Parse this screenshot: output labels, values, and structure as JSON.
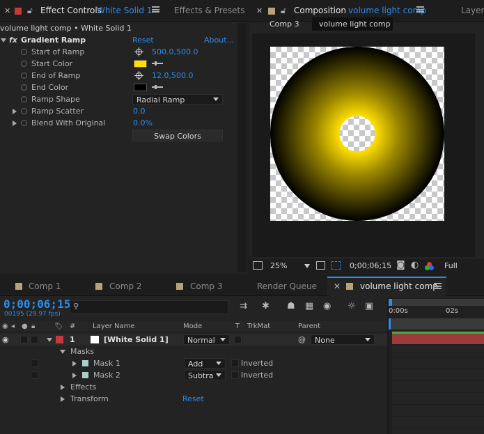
{
  "colors": {
    "accent": "#2d8ceb",
    "label_red": "#c83a3a",
    "label_tan": "#b8a27a",
    "start_color": "#ffde00",
    "end_color": "#000000",
    "layer_bar": "#9c3a3a",
    "work_area": "#2d8ceb"
  },
  "effect_controls": {
    "tab_title": "Effect Controls",
    "tab_layer": "White Solid 1",
    "tab_presets": "Effects & Presets",
    "breadcrumb": "volume light comp • White Solid 1",
    "effect_name": "Gradient Ramp",
    "reset": "Reset",
    "about": "About...",
    "props": {
      "start_of_ramp": {
        "label": "Start of Ramp",
        "value": "500.0,500.0"
      },
      "start_color": {
        "label": "Start Color"
      },
      "end_of_ramp": {
        "label": "End of Ramp",
        "value": "12.0,500.0"
      },
      "end_color": {
        "label": "End Color"
      },
      "ramp_shape": {
        "label": "Ramp Shape",
        "value": "Radial Ramp"
      },
      "ramp_scatter": {
        "label": "Ramp Scatter",
        "value": "0.0"
      },
      "blend_with_original": {
        "label": "Blend With Original",
        "value": "0.0%"
      }
    },
    "swap_colors": "Swap Colors"
  },
  "composition": {
    "tab_prefix": "Composition",
    "tab_name": "volume light comp",
    "tab_layer": "Layer",
    "nav": [
      "Comp 3",
      "volume light comp"
    ],
    "zoom": "25%",
    "timecode": "0;00;06;15",
    "resolution": "Full"
  },
  "timeline": {
    "tabs": [
      "Comp 1",
      "Comp 2",
      "Comp 3",
      "Render Queue",
      "volume light comp"
    ],
    "timecode": "0;00;06;15",
    "frame_info": "00195 (29.97 fps)",
    "search_placeholder": "",
    "columns": {
      "num": "#",
      "layer_name": "Layer Name",
      "mode": "Mode",
      "t": "T",
      "trkmat": "TrkMat",
      "parent": "Parent"
    },
    "ruler": [
      "0:00s",
      "02s"
    ],
    "layer": {
      "number": "1",
      "name": "[White Solid 1]",
      "mode": "Normal",
      "parent": "None"
    },
    "masks_label": "Masks",
    "masks": [
      {
        "name": "Mask 1",
        "mode": "Add",
        "inverted": "Inverted"
      },
      {
        "name": "Mask 2",
        "mode": "Subtract",
        "inverted": "Inverted"
      }
    ],
    "effects_label": "Effects",
    "transform_label": "Transform",
    "transform_reset": "Reset"
  }
}
